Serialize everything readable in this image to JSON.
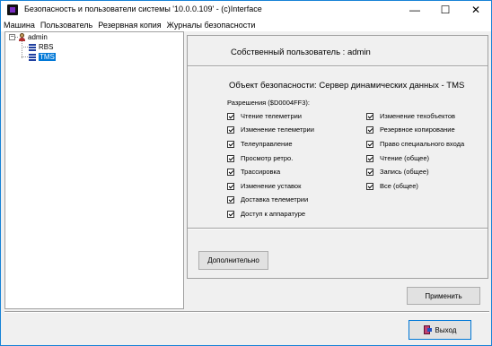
{
  "window": {
    "title": "Безопасность и пользователи системы '10.0.0.109' - (c)Interface",
    "minimize": "—",
    "maximize": "☐",
    "close": "✕"
  },
  "menu": [
    "Машина",
    "Пользователь",
    "Резервная копия",
    "Журналы безопасности"
  ],
  "tree": {
    "root": "admin",
    "children": [
      "RBS",
      "TMS"
    ],
    "selected": "TMS"
  },
  "panel": {
    "owner_label": "Собственный пользователь :",
    "owner_value": "admin",
    "object_label": "Объект безопасности:",
    "object_value": "Сервер динамических данных - TMS",
    "permissions_title": "Разрешения ($D0004FF3):",
    "left_permissions": [
      {
        "label": "Чтение телеметрии",
        "checked": true
      },
      {
        "label": "Изменение телеметрии",
        "checked": true
      },
      {
        "label": "Телеуправление",
        "checked": true
      },
      {
        "label": "Просмотр ретро.",
        "checked": true
      },
      {
        "label": "Трассировка",
        "checked": true
      },
      {
        "label": "Изменение уставок",
        "checked": true
      },
      {
        "label": "Доставка телеметрии",
        "checked": true
      },
      {
        "label": "Доступ к аппаратуре",
        "checked": true
      }
    ],
    "right_permissions": [
      {
        "label": "Изменение техобъектов",
        "checked": true
      },
      {
        "label": "Резервное копирование",
        "checked": true
      },
      {
        "label": "Право специального входа",
        "checked": true
      },
      {
        "label": "Чтение (общее)",
        "checked": true
      },
      {
        "label": "Запись (общее)",
        "checked": true
      },
      {
        "label": "Все (общее)",
        "checked": true
      }
    ],
    "advanced_button": "Дополнительно"
  },
  "buttons": {
    "apply": "Применить",
    "exit": "Выход"
  }
}
